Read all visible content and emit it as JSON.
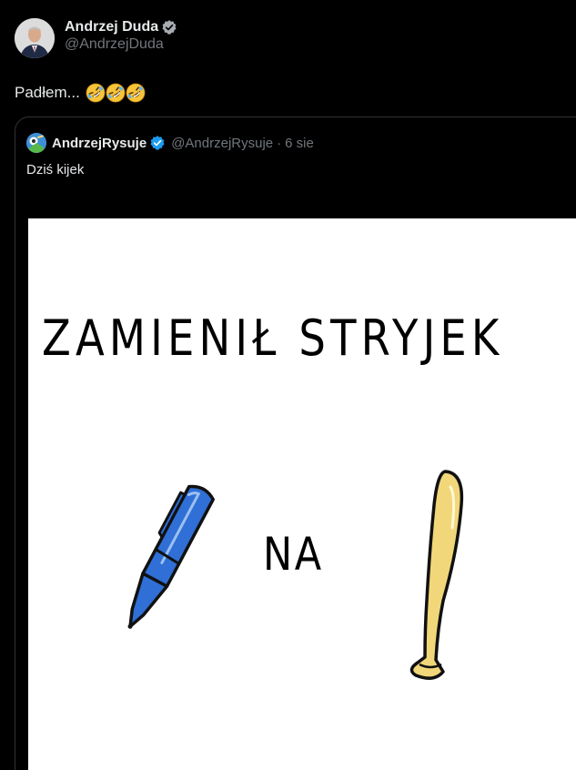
{
  "post": {
    "author": {
      "display_name": "Andrzej Duda",
      "handle": "@AndrzejDuda",
      "verified": true
    },
    "text": "Padłem...",
    "emojis": [
      "rolling-on-floor-laughing",
      "rolling-on-floor-laughing",
      "rolling-on-floor-laughing"
    ]
  },
  "quoted": {
    "author": {
      "display_name": "AndrzejRysuje",
      "handle": "@AndrzejRysuje",
      "verified": true
    },
    "separator": "·",
    "date": "6 sie",
    "text": "Dziś kijek",
    "image": {
      "title": "ZAMIENIŁ STRYJEK",
      "middle_word": "NA",
      "left_object": "blue-pen",
      "right_object": "baseball-bat"
    }
  },
  "colors": {
    "background": "#000000",
    "text_primary": "#e7e9ea",
    "text_secondary": "#71767b",
    "verified_blue": "#1d9bf0",
    "border": "#2f3336",
    "pen_blue": "#2f6fd6",
    "bat_yellow": "#f2d77a"
  }
}
